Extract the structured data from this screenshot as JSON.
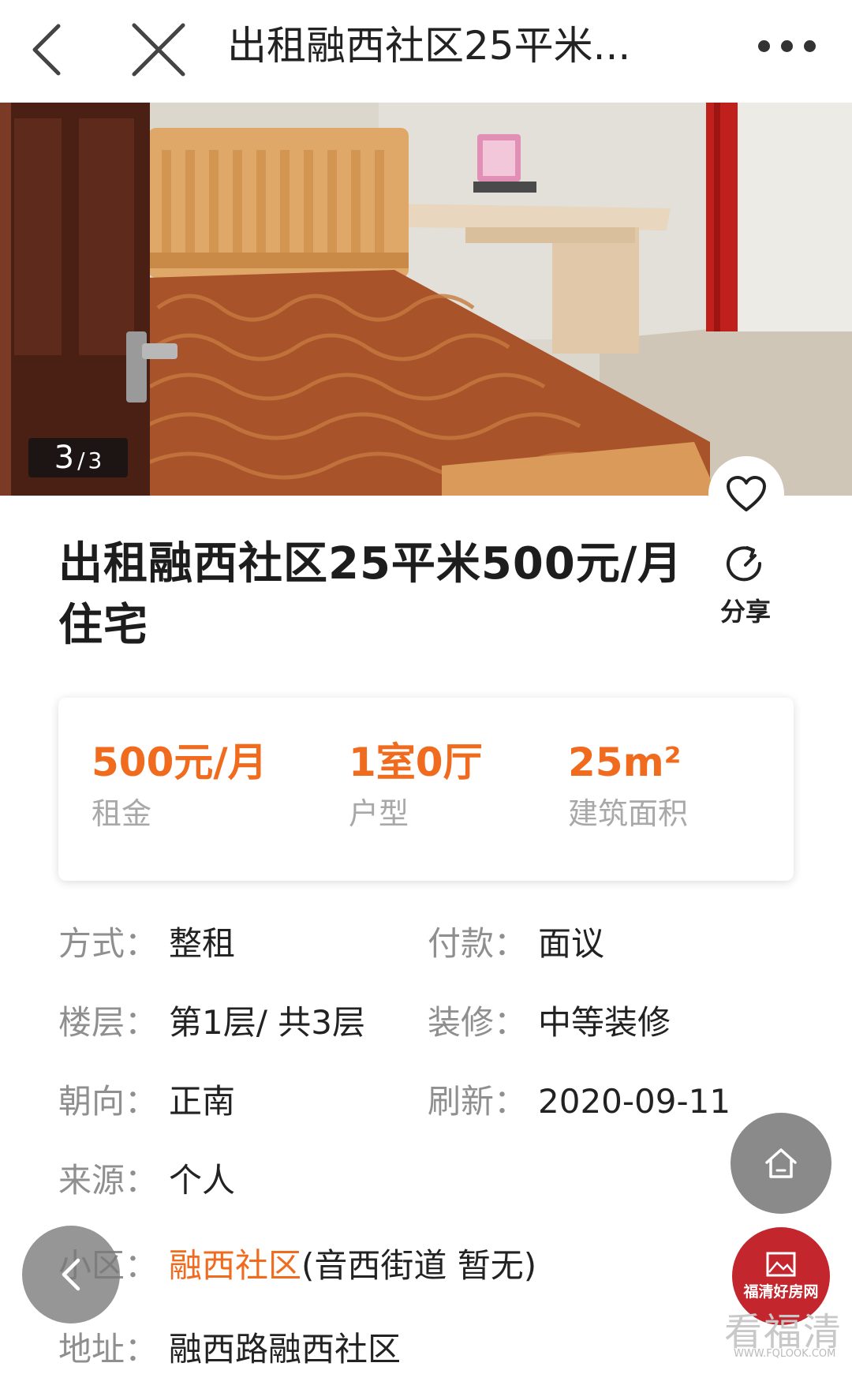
{
  "nav": {
    "title": "出租融西社区25平米...",
    "back_icon": "chevron-left-icon",
    "close_icon": "close-icon",
    "more_icon": "more-dots-icon"
  },
  "gallery": {
    "current": "3",
    "separator": "/",
    "total": "3"
  },
  "listing": {
    "title": "出租融西社区25平米500元/月住宅",
    "share_label": "分享"
  },
  "summary": [
    {
      "value": "500元/月",
      "label": "租金"
    },
    {
      "value": "1室0厅",
      "label": "户型"
    },
    {
      "value": "25m²",
      "label": "建筑面积"
    }
  ],
  "details": {
    "mode": {
      "key": "方式：",
      "value": "整租"
    },
    "payment": {
      "key": "付款：",
      "value": "面议"
    },
    "floor": {
      "key": "楼层：",
      "value": "第1层/ 共3层"
    },
    "decor": {
      "key": "装修：",
      "value": "中等装修"
    },
    "facing": {
      "key": "朝向：",
      "value": "正南"
    },
    "refresh": {
      "key": "刷新：",
      "value": "2020-09-11"
    },
    "source": {
      "key": "来源：",
      "value": "个人"
    },
    "community": {
      "key": "小区：",
      "link": "融西社区",
      "extra": "(音西街道 暂无)"
    },
    "address": {
      "key": "地址：",
      "value": "融西路融西社区"
    }
  },
  "branding": {
    "badge_name": "福清好房网",
    "watermark": "看福清",
    "watermark_url": "WWW.FQLOOK.COM"
  },
  "colors": {
    "accent": "#f06b1e",
    "badge": "#c4262e",
    "label_gray": "#8f8f8f"
  }
}
